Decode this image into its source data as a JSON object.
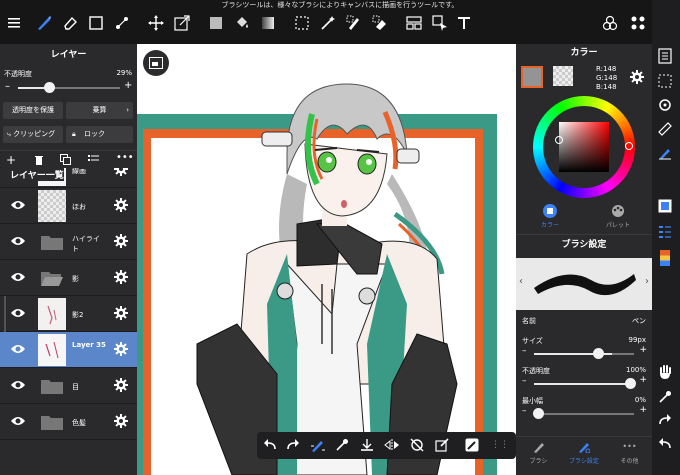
{
  "hint": "ブラシツールは、様々なブラシによりキャンバスに描画を行うツールです。",
  "layer_panel": {
    "title": "レイヤー",
    "opacity_label": "不透明度",
    "opacity_value": "29%",
    "opacity_fraction": 0.29,
    "protect_alpha": "透明度を保護",
    "blend_mode": "乗算",
    "clipping": "クリッピング",
    "lock": "ロック",
    "list_title": "レイヤー一覧",
    "layers": [
      {
        "name": "線画",
        "type": "image"
      },
      {
        "name": "ほお",
        "type": "image"
      },
      {
        "name": "ハイライト",
        "type": "folder"
      },
      {
        "name": "影",
        "type": "folder"
      },
      {
        "name": "影2",
        "type": "image"
      },
      {
        "name": "Layer 35",
        "type": "image",
        "selected": true
      },
      {
        "name": "目",
        "type": "folder"
      },
      {
        "name": "色髪",
        "type": "folder"
      }
    ]
  },
  "color_panel": {
    "title": "カラー",
    "r": "R:148",
    "g": "G:148",
    "b": "B:148",
    "current_color": "#949494",
    "tab_color": "カラー",
    "tab_palette": "パレット"
  },
  "brush_panel": {
    "title": "ブラシ設定",
    "name_label": "名前",
    "name_value": "ペン",
    "size_label": "サイズ",
    "size_value": "99px",
    "size_fraction": 0.75,
    "opacity_label": "不透明度",
    "opacity_value": "100%",
    "opacity_fraction": 1.0,
    "min_width_label": "最小幅",
    "min_width_value": "0%",
    "min_width_fraction": 0.0,
    "tab_brush": "ブラシ",
    "tab_brush_settings": "ブラシ設定",
    "tab_other": "その他"
  },
  "colors": {
    "accent": "#3b82f6",
    "selected_layer": "#5b86c9",
    "frame_teal": "#3a9a85",
    "frame_orange": "#e8632a"
  }
}
